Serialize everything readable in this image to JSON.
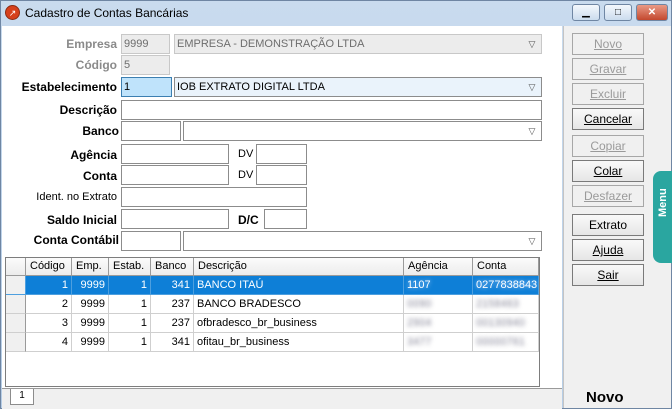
{
  "window": {
    "title": "Cadastro de Contas Bancárias",
    "minimize": "▁",
    "maximize": "□",
    "close": "✕"
  },
  "form": {
    "empresa": {
      "label": "Empresa",
      "code": "9999",
      "name": "EMPRESA - DEMONSTRAÇÃO LTDA"
    },
    "codigo": {
      "label": "Código",
      "value": "5"
    },
    "estabelecimento": {
      "label": "Estabelecimento",
      "code": "1",
      "name": "IOB EXTRATO DIGITAL LTDA"
    },
    "descricao": {
      "label": "Descrição",
      "value": ""
    },
    "banco": {
      "label": "Banco",
      "code": "",
      "name": ""
    },
    "agencia": {
      "label": "Agência",
      "value": "",
      "dv_label": "DV",
      "dv": ""
    },
    "conta": {
      "label": "Conta",
      "value": "",
      "dv_label": "DV",
      "dv": ""
    },
    "ident_extrato": {
      "label": "Ident. no Extrato",
      "value": ""
    },
    "saldo_inicial": {
      "label": "Saldo Inicial",
      "value": "",
      "dc_label": "D/C",
      "dc": ""
    },
    "conta_contabil": {
      "label": "Conta Contábil",
      "code": "",
      "name": ""
    }
  },
  "grid": {
    "columns": [
      "Código",
      "Emp.",
      "Estab.",
      "Banco",
      "Descrição",
      "Agência",
      "Conta"
    ],
    "rows": [
      [
        "1",
        "9999",
        "1",
        "341",
        "BANCO ITAÚ",
        "1107",
        "0277838843"
      ],
      [
        "2",
        "9999",
        "1",
        "237",
        "BANCO BRADESCO",
        "0090",
        "2158463"
      ],
      [
        "3",
        "9999",
        "1",
        "237",
        "ofbradesco_br_business",
        "2904",
        "00130940"
      ],
      [
        "4",
        "9999",
        "1",
        "341",
        "ofitau_br_business",
        "3477",
        "00000761"
      ]
    ]
  },
  "sidebar": {
    "buttons": [
      {
        "label": "Novo",
        "enabled": false
      },
      {
        "label": "Gravar",
        "enabled": false
      },
      {
        "label": "Excluir",
        "enabled": false
      },
      {
        "label": "Cancelar",
        "enabled": true
      },
      {
        "label": "Copiar",
        "enabled": false
      },
      {
        "label": "Colar",
        "enabled": true
      },
      {
        "label": "Desfazer",
        "enabled": false
      },
      {
        "label": "Extrato digital",
        "enabled": true
      },
      {
        "label": "Ajuda",
        "enabled": true
      },
      {
        "label": "Sair",
        "enabled": true
      }
    ],
    "menu_tab": "Menu"
  },
  "tabs": {
    "active": "1"
  },
  "status": "Novo"
}
